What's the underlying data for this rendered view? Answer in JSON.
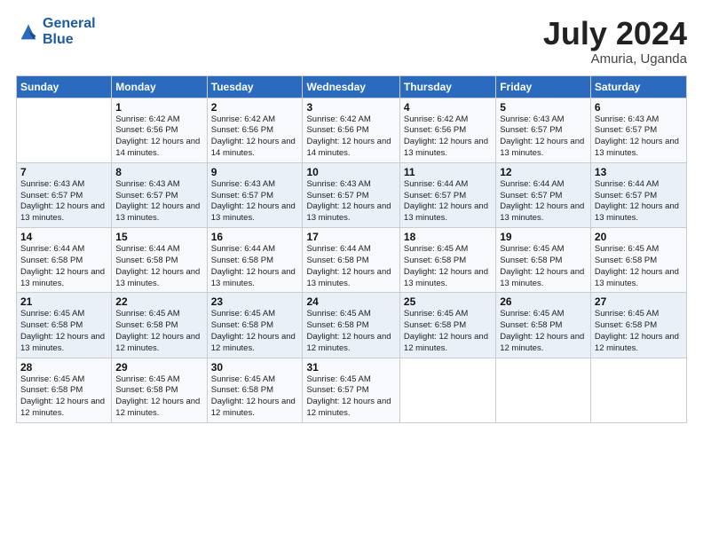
{
  "header": {
    "logo_line1": "General",
    "logo_line2": "Blue",
    "month": "July 2024",
    "location": "Amuria, Uganda"
  },
  "weekdays": [
    "Sunday",
    "Monday",
    "Tuesday",
    "Wednesday",
    "Thursday",
    "Friday",
    "Saturday"
  ],
  "weeks": [
    [
      {
        "day": "",
        "sunrise": "",
        "sunset": "",
        "daylight": ""
      },
      {
        "day": "1",
        "sunrise": "Sunrise: 6:42 AM",
        "sunset": "Sunset: 6:56 PM",
        "daylight": "Daylight: 12 hours and 14 minutes."
      },
      {
        "day": "2",
        "sunrise": "Sunrise: 6:42 AM",
        "sunset": "Sunset: 6:56 PM",
        "daylight": "Daylight: 12 hours and 14 minutes."
      },
      {
        "day": "3",
        "sunrise": "Sunrise: 6:42 AM",
        "sunset": "Sunset: 6:56 PM",
        "daylight": "Daylight: 12 hours and 14 minutes."
      },
      {
        "day": "4",
        "sunrise": "Sunrise: 6:42 AM",
        "sunset": "Sunset: 6:56 PM",
        "daylight": "Daylight: 12 hours and 13 minutes."
      },
      {
        "day": "5",
        "sunrise": "Sunrise: 6:43 AM",
        "sunset": "Sunset: 6:57 PM",
        "daylight": "Daylight: 12 hours and 13 minutes."
      },
      {
        "day": "6",
        "sunrise": "Sunrise: 6:43 AM",
        "sunset": "Sunset: 6:57 PM",
        "daylight": "Daylight: 12 hours and 13 minutes."
      }
    ],
    [
      {
        "day": "7",
        "sunrise": "Sunrise: 6:43 AM",
        "sunset": "Sunset: 6:57 PM",
        "daylight": "Daylight: 12 hours and 13 minutes."
      },
      {
        "day": "8",
        "sunrise": "Sunrise: 6:43 AM",
        "sunset": "Sunset: 6:57 PM",
        "daylight": "Daylight: 12 hours and 13 minutes."
      },
      {
        "day": "9",
        "sunrise": "Sunrise: 6:43 AM",
        "sunset": "Sunset: 6:57 PM",
        "daylight": "Daylight: 12 hours and 13 minutes."
      },
      {
        "day": "10",
        "sunrise": "Sunrise: 6:43 AM",
        "sunset": "Sunset: 6:57 PM",
        "daylight": "Daylight: 12 hours and 13 minutes."
      },
      {
        "day": "11",
        "sunrise": "Sunrise: 6:44 AM",
        "sunset": "Sunset: 6:57 PM",
        "daylight": "Daylight: 12 hours and 13 minutes."
      },
      {
        "day": "12",
        "sunrise": "Sunrise: 6:44 AM",
        "sunset": "Sunset: 6:57 PM",
        "daylight": "Daylight: 12 hours and 13 minutes."
      },
      {
        "day": "13",
        "sunrise": "Sunrise: 6:44 AM",
        "sunset": "Sunset: 6:57 PM",
        "daylight": "Daylight: 12 hours and 13 minutes."
      }
    ],
    [
      {
        "day": "14",
        "sunrise": "Sunrise: 6:44 AM",
        "sunset": "Sunset: 6:58 PM",
        "daylight": "Daylight: 12 hours and 13 minutes."
      },
      {
        "day": "15",
        "sunrise": "Sunrise: 6:44 AM",
        "sunset": "Sunset: 6:58 PM",
        "daylight": "Daylight: 12 hours and 13 minutes."
      },
      {
        "day": "16",
        "sunrise": "Sunrise: 6:44 AM",
        "sunset": "Sunset: 6:58 PM",
        "daylight": "Daylight: 12 hours and 13 minutes."
      },
      {
        "day": "17",
        "sunrise": "Sunrise: 6:44 AM",
        "sunset": "Sunset: 6:58 PM",
        "daylight": "Daylight: 12 hours and 13 minutes."
      },
      {
        "day": "18",
        "sunrise": "Sunrise: 6:45 AM",
        "sunset": "Sunset: 6:58 PM",
        "daylight": "Daylight: 12 hours and 13 minutes."
      },
      {
        "day": "19",
        "sunrise": "Sunrise: 6:45 AM",
        "sunset": "Sunset: 6:58 PM",
        "daylight": "Daylight: 12 hours and 13 minutes."
      },
      {
        "day": "20",
        "sunrise": "Sunrise: 6:45 AM",
        "sunset": "Sunset: 6:58 PM",
        "daylight": "Daylight: 12 hours and 13 minutes."
      }
    ],
    [
      {
        "day": "21",
        "sunrise": "Sunrise: 6:45 AM",
        "sunset": "Sunset: 6:58 PM",
        "daylight": "Daylight: 12 hours and 13 minutes."
      },
      {
        "day": "22",
        "sunrise": "Sunrise: 6:45 AM",
        "sunset": "Sunset: 6:58 PM",
        "daylight": "Daylight: 12 hours and 12 minutes."
      },
      {
        "day": "23",
        "sunrise": "Sunrise: 6:45 AM",
        "sunset": "Sunset: 6:58 PM",
        "daylight": "Daylight: 12 hours and 12 minutes."
      },
      {
        "day": "24",
        "sunrise": "Sunrise: 6:45 AM",
        "sunset": "Sunset: 6:58 PM",
        "daylight": "Daylight: 12 hours and 12 minutes."
      },
      {
        "day": "25",
        "sunrise": "Sunrise: 6:45 AM",
        "sunset": "Sunset: 6:58 PM",
        "daylight": "Daylight: 12 hours and 12 minutes."
      },
      {
        "day": "26",
        "sunrise": "Sunrise: 6:45 AM",
        "sunset": "Sunset: 6:58 PM",
        "daylight": "Daylight: 12 hours and 12 minutes."
      },
      {
        "day": "27",
        "sunrise": "Sunrise: 6:45 AM",
        "sunset": "Sunset: 6:58 PM",
        "daylight": "Daylight: 12 hours and 12 minutes."
      }
    ],
    [
      {
        "day": "28",
        "sunrise": "Sunrise: 6:45 AM",
        "sunset": "Sunset: 6:58 PM",
        "daylight": "Daylight: 12 hours and 12 minutes."
      },
      {
        "day": "29",
        "sunrise": "Sunrise: 6:45 AM",
        "sunset": "Sunset: 6:58 PM",
        "daylight": "Daylight: 12 hours and 12 minutes."
      },
      {
        "day": "30",
        "sunrise": "Sunrise: 6:45 AM",
        "sunset": "Sunset: 6:58 PM",
        "daylight": "Daylight: 12 hours and 12 minutes."
      },
      {
        "day": "31",
        "sunrise": "Sunrise: 6:45 AM",
        "sunset": "Sunset: 6:57 PM",
        "daylight": "Daylight: 12 hours and 12 minutes."
      },
      {
        "day": "",
        "sunrise": "",
        "sunset": "",
        "daylight": ""
      },
      {
        "day": "",
        "sunrise": "",
        "sunset": "",
        "daylight": ""
      },
      {
        "day": "",
        "sunrise": "",
        "sunset": "",
        "daylight": ""
      }
    ]
  ]
}
